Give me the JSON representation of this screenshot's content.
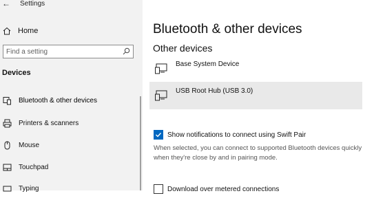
{
  "window": {
    "back_glyph": "←",
    "title": "Settings"
  },
  "sidebar": {
    "home_label": "Home",
    "search_placeholder": "Find a setting",
    "section_heading": "Devices",
    "items": [
      {
        "label": "Bluetooth & other devices",
        "icon": "bluetooth-devices-icon"
      },
      {
        "label": "Printers & scanners",
        "icon": "printer-icon"
      },
      {
        "label": "Mouse",
        "icon": "mouse-icon"
      },
      {
        "label": "Touchpad",
        "icon": "touchpad-icon"
      },
      {
        "label": "Typing",
        "icon": "keyboard-icon"
      }
    ]
  },
  "main": {
    "title": "Bluetooth & other devices",
    "subtitle": "Other devices",
    "devices": [
      {
        "name": "Base System Device",
        "icon": "device-icon"
      },
      {
        "name": "USB Root Hub (USB 3.0)",
        "icon": "device-icon"
      }
    ],
    "swift_pair": {
      "label": "Show notifications to connect using Swift Pair",
      "checked": true,
      "description": "When selected, you can connect to supported Bluetooth devices quickly when they're close by and in pairing mode."
    },
    "metered": {
      "label": "Download over metered connections",
      "checked": false
    }
  },
  "colors": {
    "accent": "#0067c0",
    "sidebar_bg": "#f2f2f2",
    "selected_row": "#e9e9e9"
  }
}
